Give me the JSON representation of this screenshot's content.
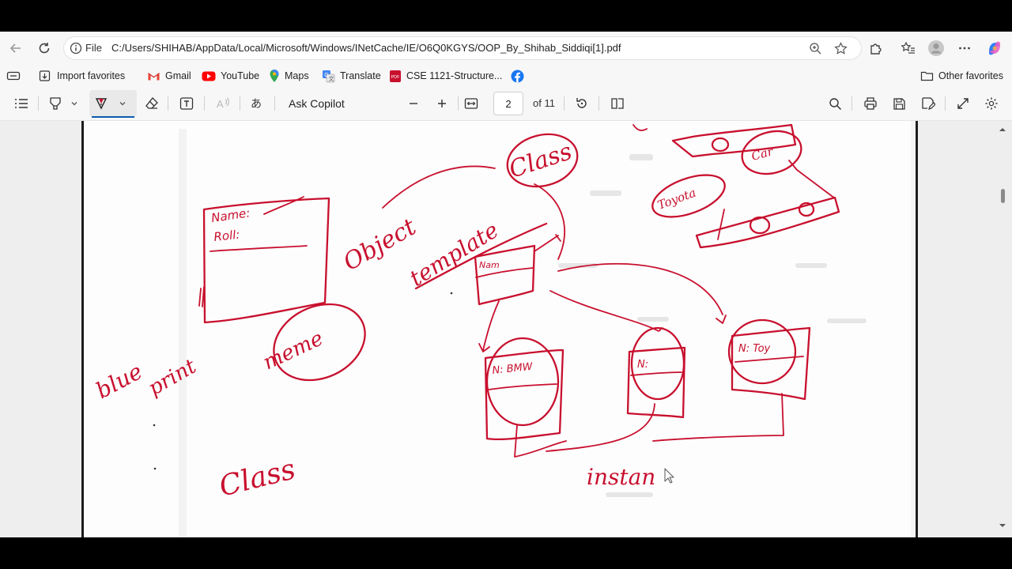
{
  "address_bar": {
    "file_label": "File",
    "url": "C:/Users/SHIHAB/AppData/Local/Microsoft/Windows/INetCache/IE/O6Q0KGYS/OOP_By_Shihab_Siddiqi[1].pdf"
  },
  "favorites": {
    "items": [
      {
        "label": "Import favorites",
        "icon": "import-icon"
      },
      {
        "label": "Gmail",
        "icon": "gmail-icon"
      },
      {
        "label": "YouTube",
        "icon": "youtube-icon"
      },
      {
        "label": "Maps",
        "icon": "maps-icon"
      },
      {
        "label": "Translate",
        "icon": "translate-icon"
      },
      {
        "label": "CSE 1121-Structure...",
        "icon": "pdf-icon"
      },
      {
        "label": "",
        "icon": "facebook-icon"
      }
    ],
    "other": "Other favorites"
  },
  "pdf_toolbar": {
    "ask_copilot": "Ask Copilot",
    "page_number": "2",
    "page_total": "of 11",
    "ink_color": "#c8102e"
  },
  "handwriting": {
    "name_field": "Name:",
    "roll_field": "Roll:",
    "object": "Object",
    "template": "template",
    "class_circled": "Class",
    "blueprint_1": "blue",
    "blueprint_2": "print",
    "memory": "meme",
    "class_bottom": "Class",
    "instance": "instan",
    "bmw_box": "N: BMW",
    "toy_box": "N: Toy",
    "toyota": "Toyota",
    "car": "Car"
  },
  "colors": {
    "accent": "#0b5cad",
    "ink": "#c8102e"
  }
}
